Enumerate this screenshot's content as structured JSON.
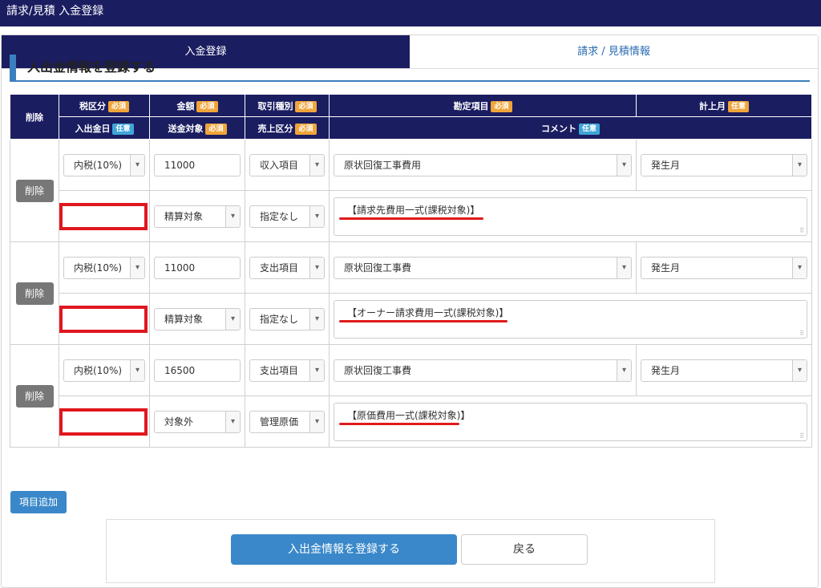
{
  "page": {
    "title": "請求/見積 入金登録"
  },
  "tabs": [
    {
      "label": "入金登録"
    },
    {
      "label": "請求 / 見積情報"
    }
  ],
  "section": {
    "title": "入出金情報を登録する"
  },
  "badges": {
    "required": "必須",
    "optional": "任意"
  },
  "headers": {
    "delete": "削除",
    "tax": "税区分",
    "amount": "金額",
    "trade_type": "取引種別",
    "account": "勘定項目",
    "month": "計上月",
    "date": "入出金日",
    "transfer": "送金対象",
    "sales_class": "売上区分",
    "comment": "コメント"
  },
  "rows": [
    {
      "delete_label": "削除",
      "tax": "内税(10%)",
      "amount": "11000",
      "trade_type": "収入項目",
      "account": "原状回復工事費用",
      "month": "発生月",
      "date": "",
      "transfer": "精算対象",
      "sales_class": "指定なし",
      "comment": "【請求先費用一式(課税対象)】"
    },
    {
      "delete_label": "削除",
      "tax": "内税(10%)",
      "amount": "11000",
      "trade_type": "支出項目",
      "account": "原状回復工事費",
      "month": "発生月",
      "date": "",
      "transfer": "精算対象",
      "sales_class": "指定なし",
      "comment": "【オーナー請求費用一式(課税対象)】"
    },
    {
      "delete_label": "削除",
      "tax": "内税(10%)",
      "amount": "16500",
      "trade_type": "支出項目",
      "account": "原状回復工事費",
      "month": "発生月",
      "date": "",
      "transfer": "対象外",
      "sales_class": "管理原価",
      "comment": "【原価費用一式(課税対象)】"
    }
  ],
  "buttons": {
    "add_item": "項目追加",
    "submit": "入出金情報を登録する",
    "back": "戻る"
  },
  "colors": {
    "navy": "#1b1d61",
    "accent_blue": "#3a88c9",
    "required_badge": "#f0a53a",
    "optional_badge": "#3fa5d8",
    "annotation_red": "#e0171f"
  }
}
